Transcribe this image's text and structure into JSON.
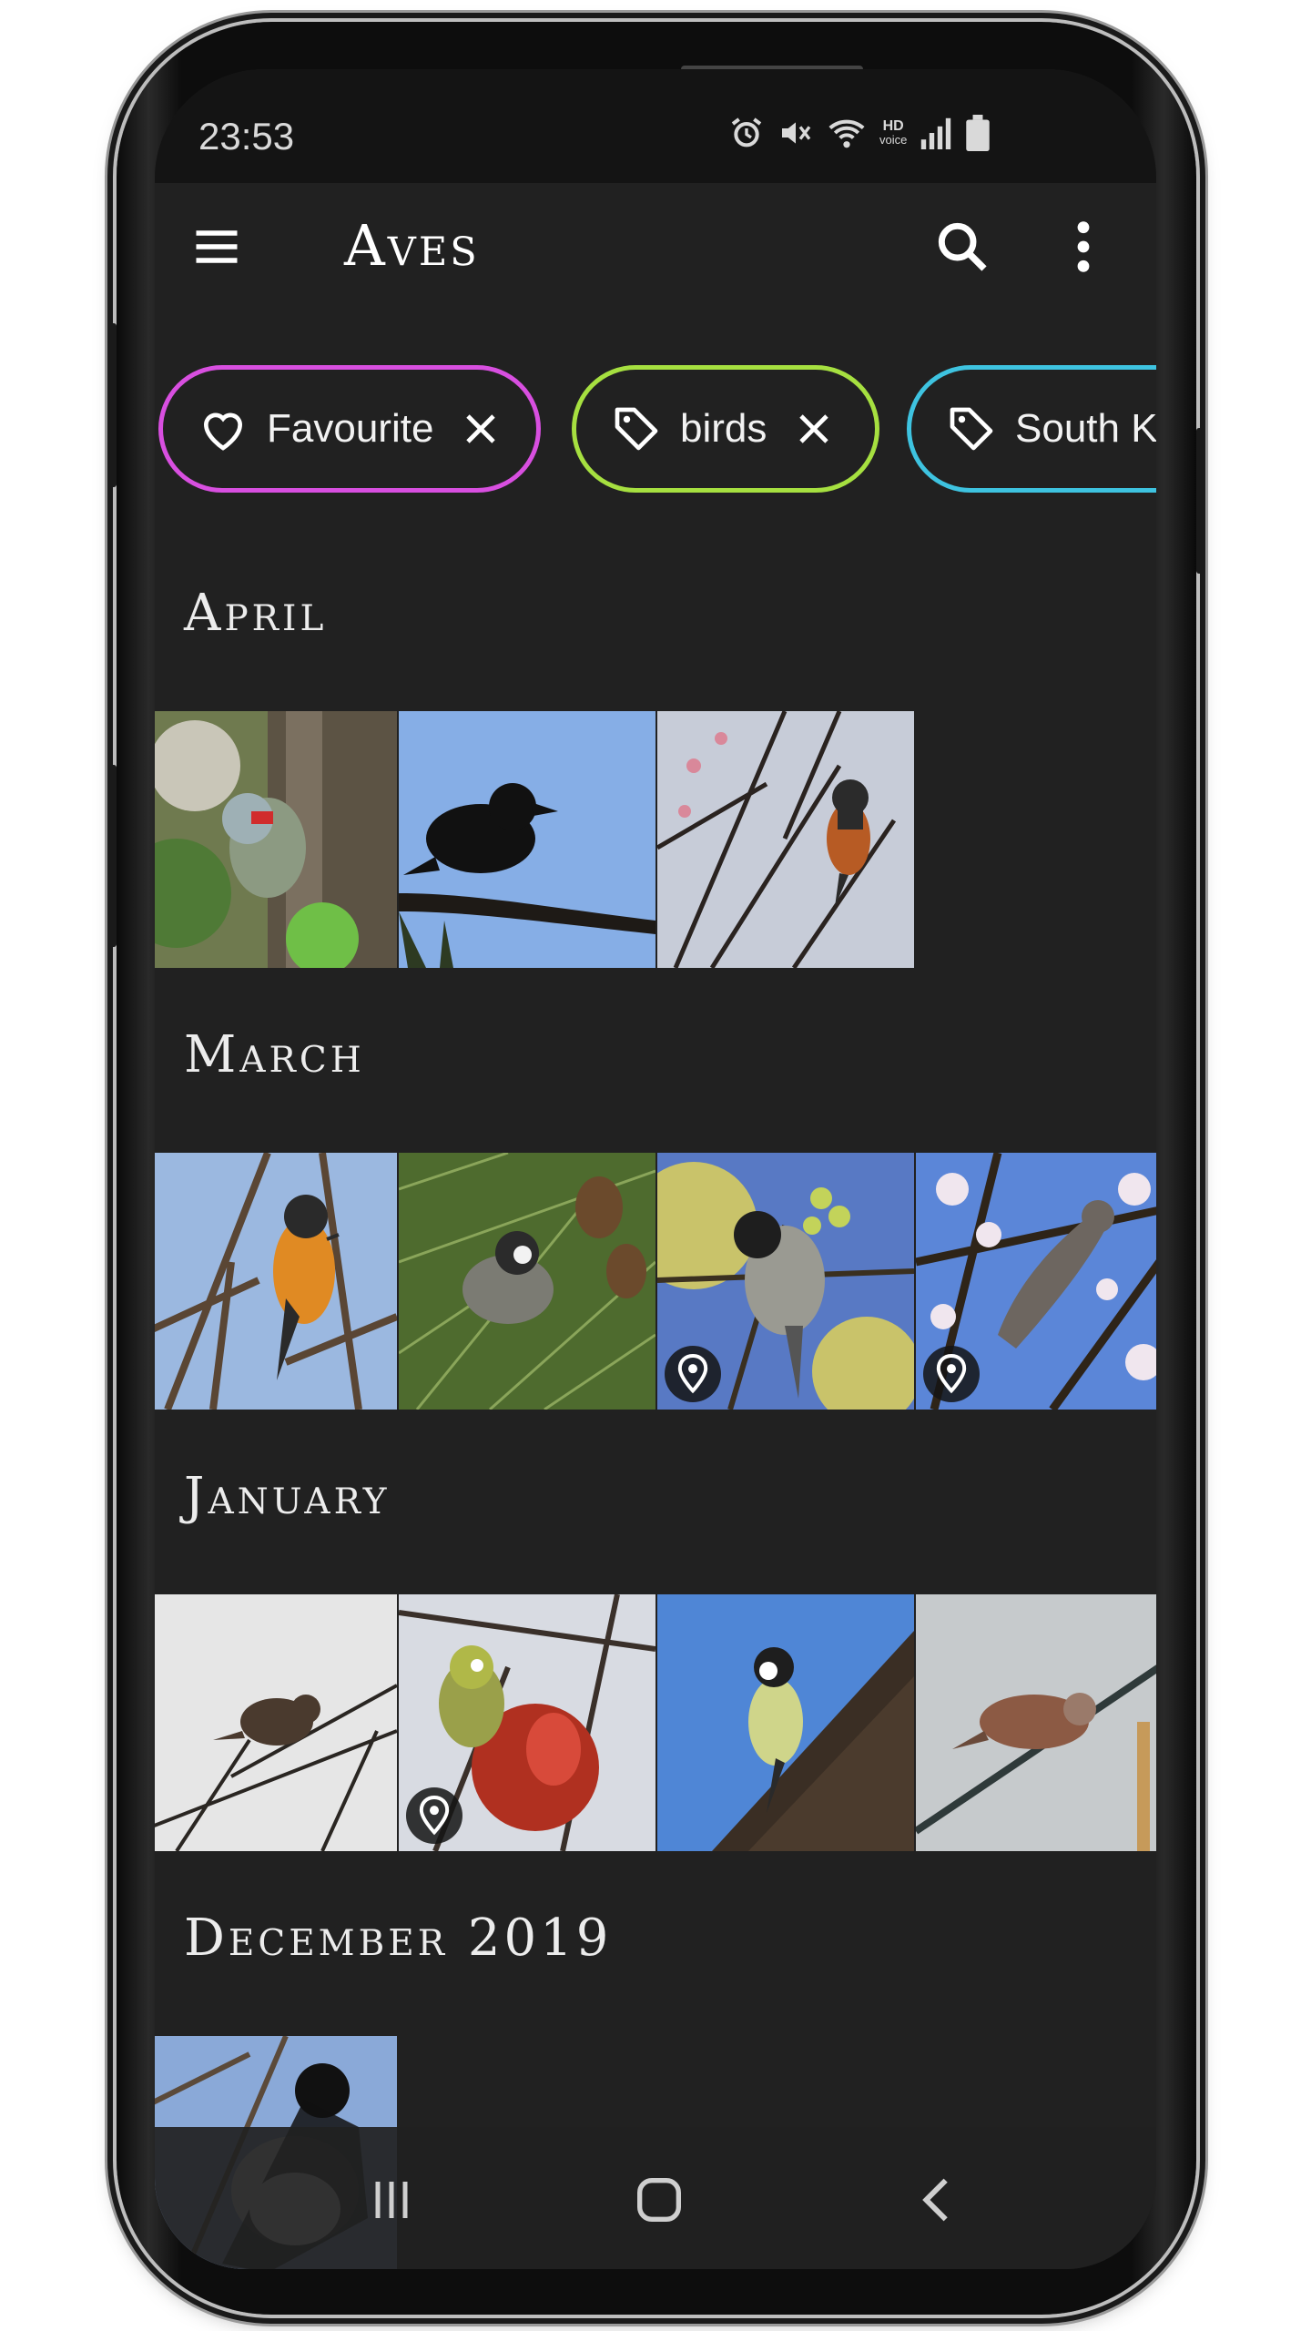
{
  "status_bar": {
    "time": "23:53",
    "hd_label": "HD",
    "voice_label": "voice"
  },
  "app_bar": {
    "title": "Aves"
  },
  "filters": [
    {
      "label": "Favourite",
      "icon": "heart-icon",
      "color": "#d84fe0"
    },
    {
      "label": "birds",
      "icon": "tag-icon",
      "color": "#a6e040"
    },
    {
      "label": "South Ko",
      "icon": "tag-icon",
      "color": "#3ec3e0"
    }
  ],
  "sections": [
    {
      "title": "April"
    },
    {
      "title": "March"
    },
    {
      "title": "January"
    },
    {
      "title": "December 2019"
    }
  ],
  "colors": {
    "background": "#212121",
    "status_bar": "#141414",
    "text": "#ffffff"
  }
}
